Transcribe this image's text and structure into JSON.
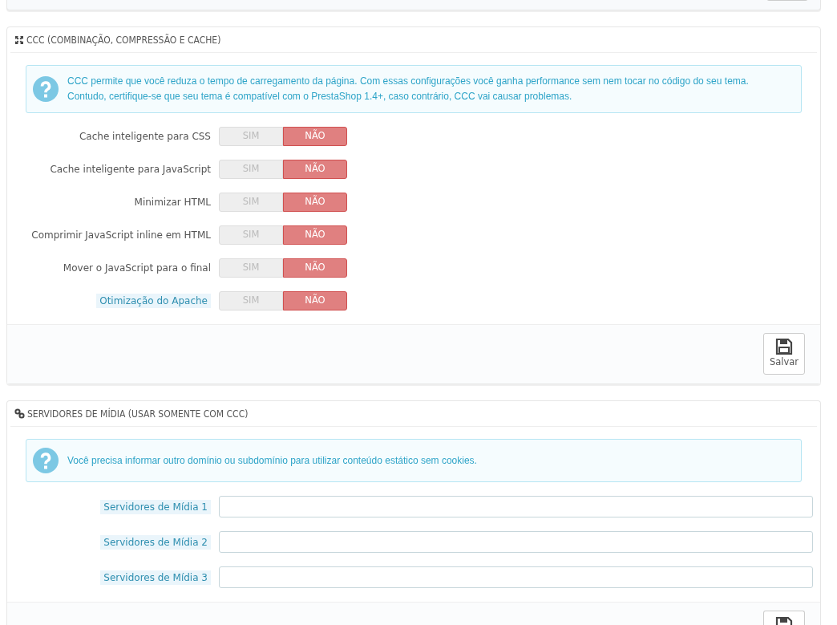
{
  "top_panel": {
    "footer_button": {
      "kind": "stub"
    }
  },
  "panels": [
    {
      "title": "CCC (COMBINAÇÃO, COMPRESSÃO E CACHE)",
      "alert": {
        "lines": [
          "CCC permite que você reduza o tempo de carregamento da página. Com essas configurações você ganha performance sem nem tocar no código do seu tema.",
          "Contudo, certifique-se que seu tema é compatível com o PrestaShop 1.4+, caso contrário, CCC vai causar problemas."
        ]
      },
      "fields": [
        {
          "kind": "switch",
          "label": "Cache inteligente para CSS",
          "has_help": false,
          "options": [
            {
              "label": "SIM",
              "selected": false
            },
            {
              "label": "NÃO",
              "selected": true
            }
          ]
        },
        {
          "kind": "switch",
          "label": "Cache inteligente para JavaScript",
          "has_help": false,
          "options": [
            {
              "label": "SIM",
              "selected": false
            },
            {
              "label": "NÃO",
              "selected": true
            }
          ]
        },
        {
          "kind": "switch",
          "label": "Minimizar HTML",
          "has_help": false,
          "options": [
            {
              "label": "SIM",
              "selected": false
            },
            {
              "label": "NÃO",
              "selected": true
            }
          ]
        },
        {
          "kind": "switch",
          "label": "Comprimir JavaScript inline em HTML",
          "has_help": false,
          "options": [
            {
              "label": "SIM",
              "selected": false
            },
            {
              "label": "NÃO",
              "selected": true
            }
          ]
        },
        {
          "kind": "switch",
          "label": "Mover o JavaScript para o final",
          "has_help": false,
          "options": [
            {
              "label": "SIM",
              "selected": false
            },
            {
              "label": "NÃO",
              "selected": true
            }
          ]
        },
        {
          "kind": "switch",
          "label": "Otimização do Apache",
          "has_help": true,
          "options": [
            {
              "label": "SIM",
              "selected": false
            },
            {
              "label": "NÃO",
              "selected": true
            }
          ]
        }
      ],
      "footer_button": {
        "kind": "labeled",
        "label": "Salvar"
      }
    },
    {
      "title": "SERVIDORES DE MÍDIA (USAR SOMENTE COM CCC)",
      "alert": {
        "lines": [
          "Você precisa informar outro domínio ou subdomínio para utilizar conteúdo estático sem cookies."
        ]
      },
      "fields": [
        {
          "kind": "text",
          "label": "Servidores de Mídia 1",
          "has_help": true
        },
        {
          "kind": "text",
          "label": "Servidores de Mídia 2",
          "has_help": true
        },
        {
          "kind": "text",
          "label": "Servidores de Mídia 3",
          "has_help": true
        }
      ],
      "footer_button": {
        "kind": "icon"
      }
    }
  ]
}
